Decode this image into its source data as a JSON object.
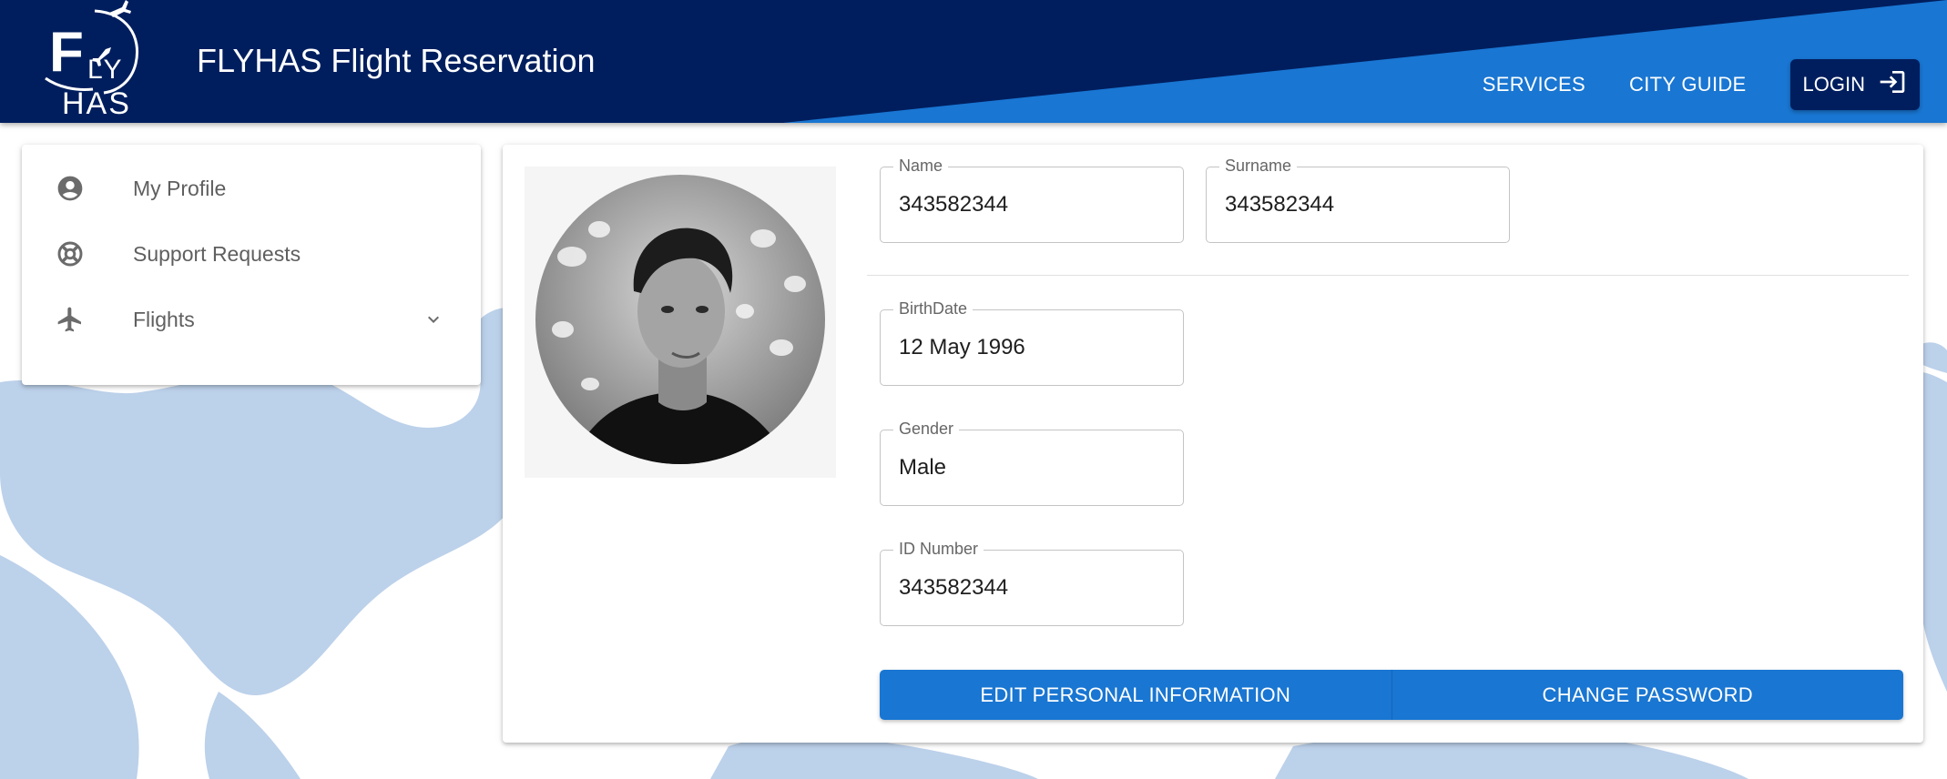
{
  "header": {
    "logo_text_top": "F LY",
    "logo_text_bottom": "HAS",
    "title": "FLYHAS Flight Reservation",
    "nav": {
      "services": "SERVICES",
      "city_guide": "CITY GUIDE",
      "login": "LOGIN"
    }
  },
  "sidebar": {
    "items": [
      {
        "label": "My Profile",
        "icon": "account-circle-icon"
      },
      {
        "label": "Support Requests",
        "icon": "lifebuoy-icon"
      },
      {
        "label": "Flights",
        "icon": "airplane-icon",
        "expandable": true
      }
    ]
  },
  "profile": {
    "photo": "profile-photo",
    "fields": {
      "name": {
        "label": "Name",
        "value": "343582344"
      },
      "surname": {
        "label": "Surname",
        "value": "343582344"
      },
      "birthdate": {
        "label": "BirthDate",
        "value": "12 May 1996"
      },
      "gender": {
        "label": "Gender",
        "value": "Male"
      },
      "id_number": {
        "label": "ID Number",
        "value": "343582344"
      }
    },
    "actions": {
      "edit": "EDIT PERSONAL INFORMATION",
      "change_password": "CHANGE PASSWORD"
    }
  },
  "colors": {
    "header_dark": "#001e5e",
    "header_accent": "#1976d2",
    "button": "#1976d2",
    "map": "#b9cfe9"
  }
}
